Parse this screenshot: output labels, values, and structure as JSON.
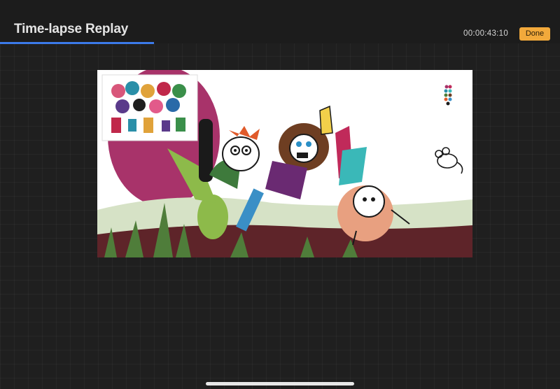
{
  "header": {
    "title": "Time-lapse Replay",
    "timecode": "00:00:43:10",
    "done_label": "Done"
  },
  "colors": {
    "accent_blue": "#3c7bea",
    "done_orange": "#f2a93b",
    "background": "#1f1f1f"
  },
  "icons": {
    "home_indicator": "home-indicator-bar"
  }
}
